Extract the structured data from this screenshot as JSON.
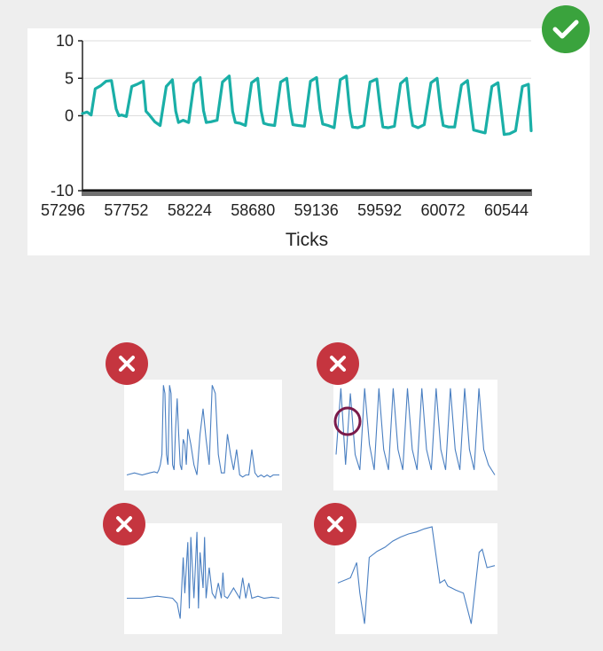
{
  "chart_data": [
    {
      "type": "line",
      "xlabel": "Ticks",
      "ylabel": "",
      "ylim": [
        -10,
        10
      ],
      "yticks": [
        "10",
        "5",
        "0",
        "-10"
      ],
      "xticks": [
        "57296",
        "57752",
        "58224",
        "58680",
        "59136",
        "59592",
        "60072",
        "60544"
      ],
      "grid": true,
      "color": "#1aafa7",
      "series": [
        {
          "x": [
            57296,
            57330,
            57360,
            57390,
            57430,
            57470,
            57510,
            57545,
            57565,
            57585,
            57620,
            57660,
            57700,
            57745,
            57765,
            57785,
            57830,
            57870,
            57915,
            57960,
            57985,
            58005,
            58040,
            58080,
            58120,
            58165,
            58190,
            58210,
            58245,
            58290,
            58330,
            58380,
            58405,
            58425,
            58460,
            58500,
            58545,
            58590,
            58615,
            58635,
            58670,
            58715,
            58760,
            58805,
            58830,
            58850,
            58890,
            58935,
            58980,
            59025,
            59050,
            59070,
            59110,
            59155,
            59200,
            59245,
            59270,
            59290,
            59330,
            59375,
            59420,
            59470,
            59495,
            59515,
            59555,
            59600,
            59645,
            59690,
            59715,
            59735,
            59775,
            59820,
            59870,
            59915,
            59940,
            59960,
            60000,
            60045,
            60095,
            60140,
            60165,
            60185,
            60225,
            60270,
            60320,
            60365,
            60390,
            60410,
            60450,
            60495,
            60545,
            60590,
            60610
          ],
          "y": [
            0.3,
            0.5,
            0.1,
            3.6,
            4.0,
            4.6,
            4.7,
            0.9,
            0.0,
            0.1,
            -0.1,
            3.9,
            4.2,
            4.6,
            0.6,
            0.2,
            -0.8,
            -1.3,
            3.9,
            4.8,
            0.6,
            -0.9,
            -0.6,
            -0.9,
            4.3,
            5.1,
            0.7,
            -0.9,
            -0.8,
            -0.6,
            4.5,
            5.3,
            0.6,
            -0.9,
            -1.0,
            -1.3,
            4.4,
            5.0,
            0.7,
            -1.0,
            -1.2,
            -1.3,
            4.5,
            5.0,
            0.9,
            -1.2,
            -1.3,
            -1.4,
            4.6,
            5.1,
            0.9,
            -1.1,
            -1.3,
            -1.6,
            4.8,
            5.3,
            0.6,
            -1.5,
            -1.6,
            -1.3,
            4.5,
            4.9,
            0.9,
            -1.5,
            -1.6,
            -1.4,
            4.3,
            5.0,
            1.0,
            -1.3,
            -1.6,
            -1.2,
            4.4,
            5.0,
            1.0,
            -1.3,
            -1.5,
            -1.5,
            4.1,
            4.7,
            0.8,
            -1.9,
            -2.1,
            -2.3,
            3.9,
            4.4,
            0.6,
            -2.5,
            -2.4,
            -2.0,
            3.9,
            4.2,
            -2.0
          ]
        }
      ]
    },
    {
      "type": "line",
      "color": "#4a7fc1",
      "series": [
        {
          "x": [
            0,
            5,
            10,
            15,
            18,
            20,
            21,
            22,
            23,
            24,
            25,
            26,
            27,
            28,
            29,
            30,
            31,
            32,
            33,
            34,
            35,
            36,
            37,
            38,
            39,
            40,
            42,
            44,
            46,
            48,
            50,
            52,
            54,
            56,
            58,
            60,
            62,
            64,
            66,
            68,
            70,
            72,
            74,
            76,
            78,
            80,
            82,
            84,
            86,
            88,
            90,
            92,
            94,
            96,
            98,
            100
          ],
          "y": [
            0.1,
            0.12,
            0.1,
            0.12,
            0.13,
            0.12,
            0.15,
            0.2,
            0.3,
            0.98,
            0.9,
            0.3,
            0.2,
            0.98,
            0.9,
            0.2,
            0.15,
            0.55,
            0.85,
            0.5,
            0.2,
            0.15,
            0.45,
            0.4,
            0.2,
            0.55,
            0.4,
            0.2,
            0.1,
            0.5,
            0.75,
            0.45,
            0.2,
            0.98,
            0.9,
            0.3,
            0.12,
            0.12,
            0.5,
            0.3,
            0.15,
            0.35,
            0.1,
            0.08,
            0.1,
            0.1,
            0.35,
            0.12,
            0.08,
            0.1,
            0.08,
            0.1,
            0.08,
            0.1,
            0.1,
            0.1
          ]
        }
      ]
    },
    {
      "type": "line",
      "color": "#4a7fc1",
      "series": [
        {
          "x": [
            0,
            3,
            6,
            9,
            12,
            15,
            18,
            21,
            24,
            27,
            30,
            33,
            36,
            39,
            42,
            45,
            48,
            51,
            54,
            57,
            60,
            63,
            66,
            69,
            72,
            75,
            78,
            81,
            84,
            87,
            90,
            93,
            96,
            100
          ],
          "y": [
            0.3,
            0.95,
            0.2,
            0.9,
            0.3,
            0.15,
            0.95,
            0.4,
            0.15,
            0.95,
            0.35,
            0.15,
            0.95,
            0.35,
            0.15,
            0.95,
            0.35,
            0.15,
            0.95,
            0.35,
            0.15,
            0.95,
            0.35,
            0.15,
            0.95,
            0.35,
            0.15,
            0.95,
            0.35,
            0.15,
            0.95,
            0.35,
            0.2,
            0.1
          ]
        }
      ]
    },
    {
      "type": "line",
      "color": "#4a7fc1",
      "series": [
        {
          "x": [
            0,
            10,
            20,
            30,
            33,
            35,
            37,
            38,
            40,
            41,
            42,
            44,
            46,
            47,
            48,
            50,
            51,
            52,
            54,
            56,
            58,
            60,
            62,
            63,
            64,
            66,
            70,
            74,
            76,
            78,
            80,
            82,
            86,
            90,
            95,
            100
          ],
          "y": [
            0.3,
            0.3,
            0.32,
            0.3,
            0.25,
            0.1,
            0.7,
            0.35,
            0.85,
            0.2,
            0.9,
            0.3,
            0.95,
            0.2,
            0.75,
            0.4,
            0.9,
            0.3,
            0.6,
            0.35,
            0.3,
            0.45,
            0.3,
            0.55,
            0.32,
            0.3,
            0.4,
            0.3,
            0.5,
            0.3,
            0.45,
            0.3,
            0.32,
            0.3,
            0.31,
            0.3
          ]
        }
      ]
    },
    {
      "type": "line",
      "color": "#4a7fc1",
      "series": [
        {
          "x": [
            0,
            8,
            12,
            14,
            17,
            20,
            25,
            30,
            35,
            40,
            45,
            50,
            55,
            60,
            65,
            68,
            70,
            75,
            80,
            85,
            90,
            92,
            95,
            100
          ],
          "y": [
            0.45,
            0.5,
            0.65,
            0.35,
            0.05,
            0.7,
            0.76,
            0.8,
            0.86,
            0.9,
            0.93,
            0.95,
            0.98,
            1.0,
            0.45,
            0.48,
            0.42,
            0.38,
            0.35,
            0.05,
            0.75,
            0.78,
            0.6,
            0.62
          ]
        }
      ]
    }
  ],
  "status": {
    "main_badge": "correct",
    "thumb_badges": [
      "incorrect",
      "incorrect",
      "incorrect",
      "incorrect"
    ]
  }
}
